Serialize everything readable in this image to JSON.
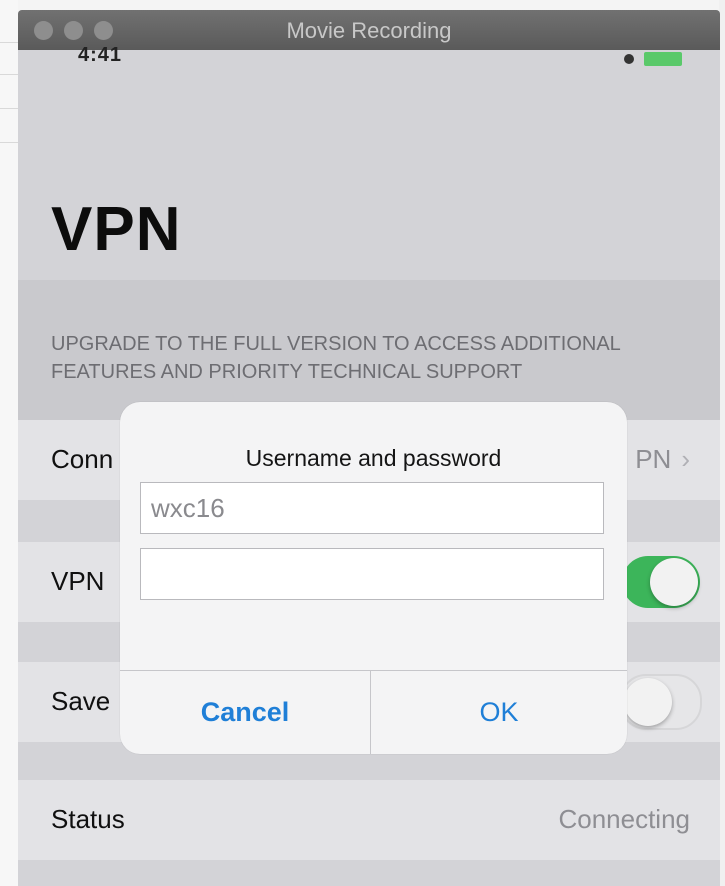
{
  "window": {
    "title": "Movie Recording"
  },
  "status_bar": {
    "time": "4:41"
  },
  "page": {
    "title": "VPN",
    "upgrade_notice": "UPGRADE TO THE FULL VERSION TO ACCESS ADDITIONAL FEATURES AND PRIORITY TECHNICAL SUPPORT"
  },
  "rows": {
    "connection_label": "Conn",
    "connection_value": "PN",
    "vpn_label": "VPN",
    "save_label": "Save",
    "status_label": "Status",
    "status_value": "Connecting"
  },
  "toggles": {
    "vpn_on": true,
    "save_on": false
  },
  "dialog": {
    "title": "Username and password",
    "username_value": "wxc16",
    "password_value": "",
    "cancel_label": "Cancel",
    "ok_label": "OK"
  },
  "icons": {
    "chevron": "chevron-right-icon"
  },
  "colors": {
    "toggle_on": "#3cb55a",
    "button_blue": "#1f7fd7"
  }
}
